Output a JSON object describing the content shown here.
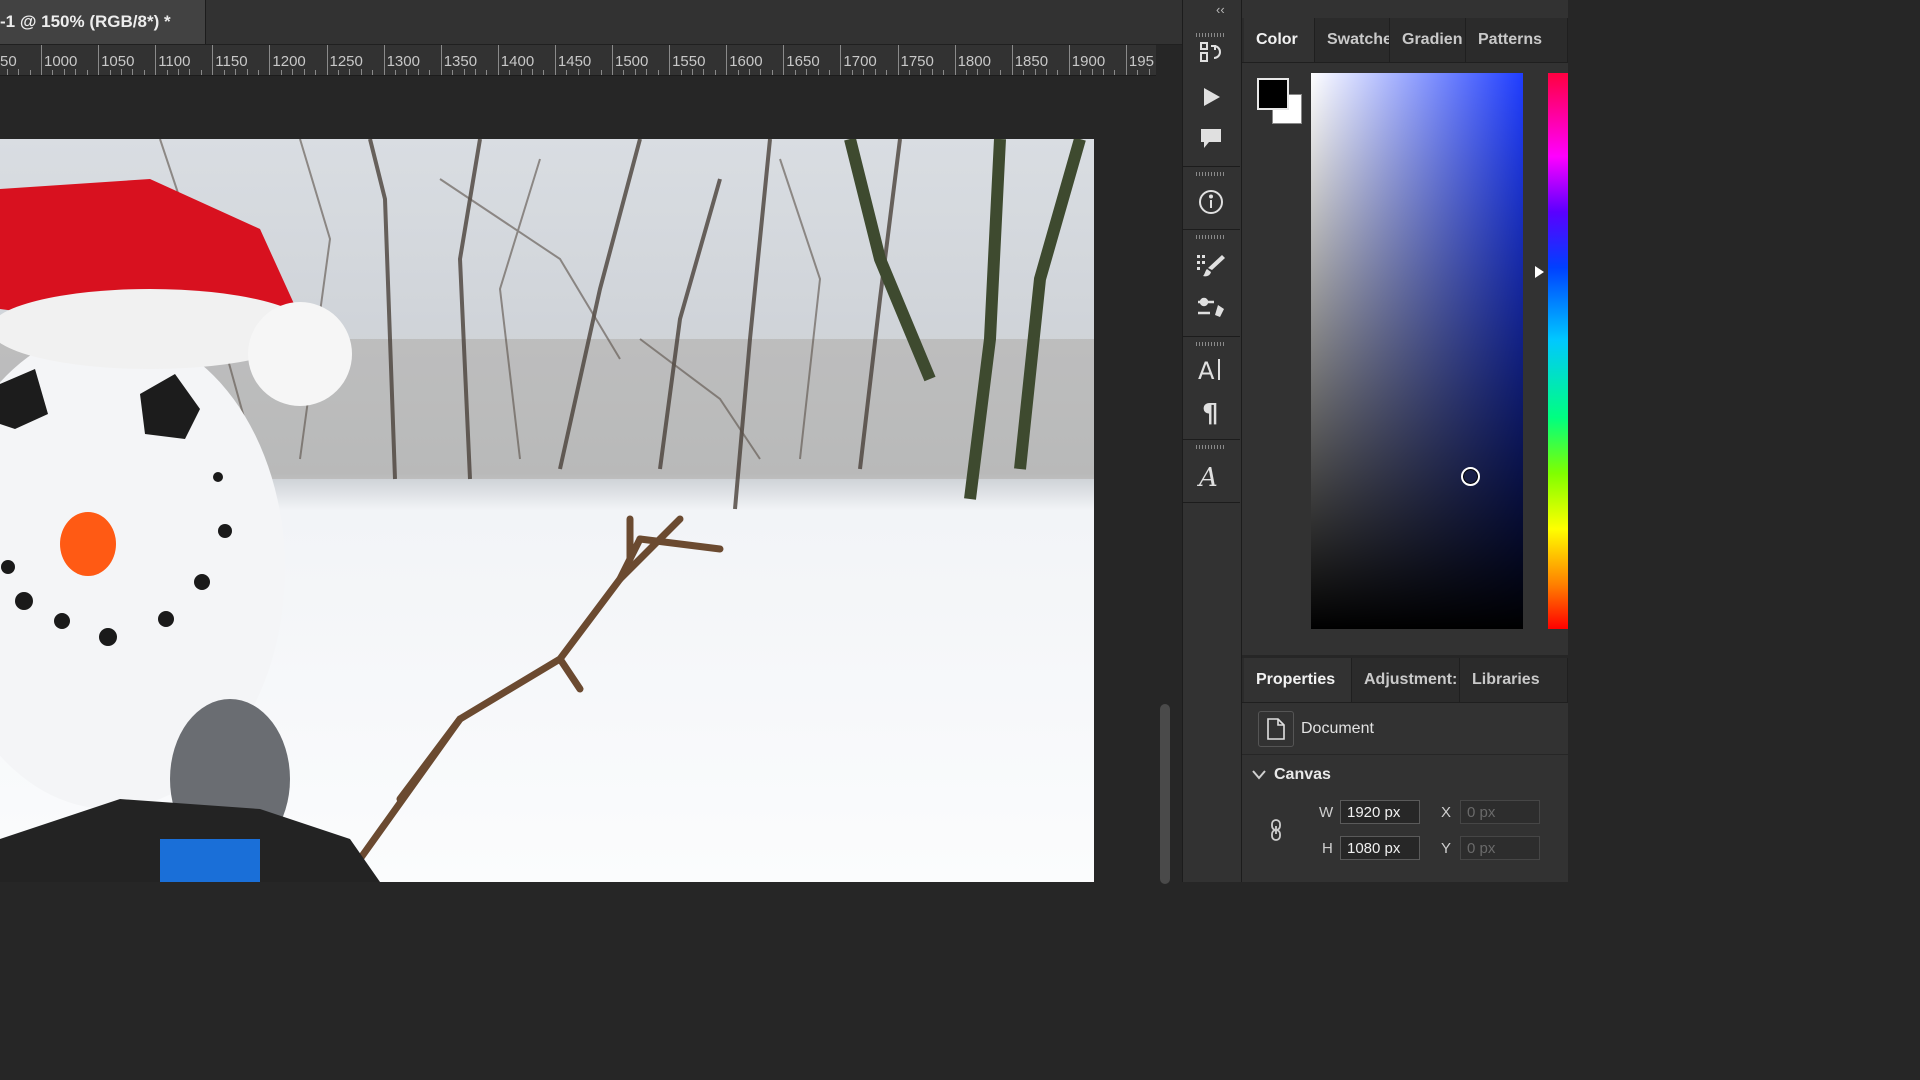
{
  "document_tab": {
    "title": "-1 @ 150% (RGB/8*) *"
  },
  "ruler": {
    "labels": [
      "50",
      "1000",
      "1050",
      "1100",
      "1150",
      "1200",
      "1250",
      "1300",
      "1350",
      "1400",
      "1450",
      "1500",
      "1550",
      "1600",
      "1650",
      "1700",
      "1750",
      "1800",
      "1850",
      "1900",
      "195"
    ]
  },
  "toolbar_icons": [
    "history-icon",
    "play-actions-icon",
    "comment-icon",
    "info-icon",
    "brush-presets-icon",
    "brush-settings-icon",
    "character-icon",
    "paragraph-icon",
    "glyphs-icon"
  ],
  "color_panel": {
    "tabs": [
      "Color",
      "Swatche",
      "Gradien",
      "Patterns"
    ],
    "foreground": "#000000",
    "background": "#ffffff",
    "hue_color": "#1f3dff"
  },
  "properties_panel": {
    "tabs": [
      "Properties",
      "Adjustment:",
      "Libraries"
    ],
    "document_label": "Document",
    "canvas_label": "Canvas",
    "fields": {
      "w_label": "W",
      "w_value": "1920 px",
      "h_label": "H",
      "h_value": "1080 px",
      "x_label": "X",
      "x_value": "0 px",
      "y_label": "Y",
      "y_value": "0 px"
    }
  },
  "collapse_label": "‹‹"
}
